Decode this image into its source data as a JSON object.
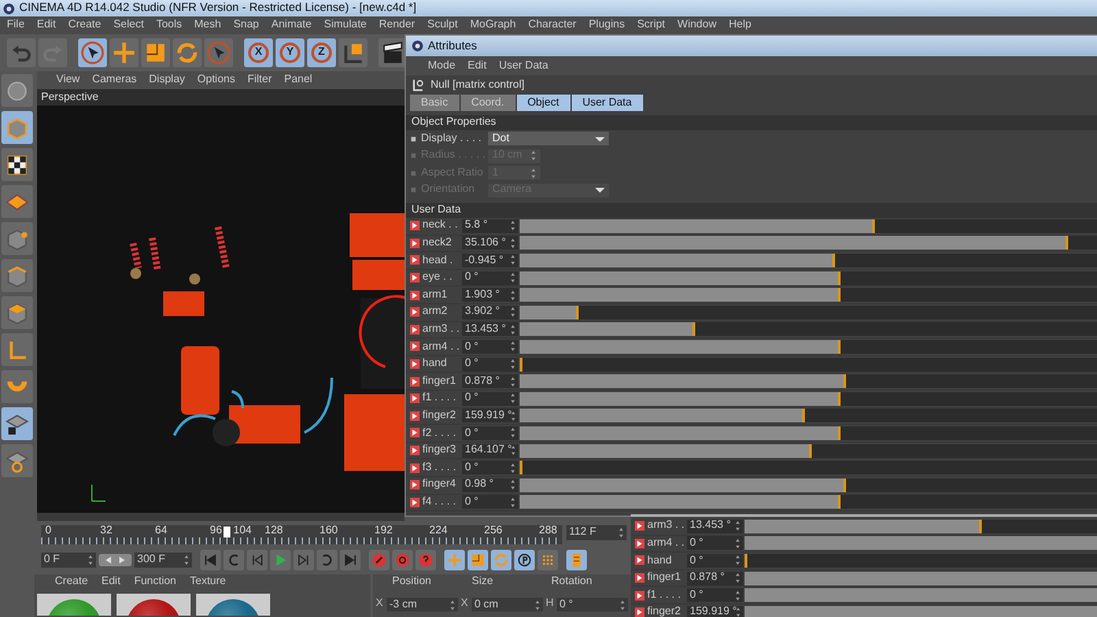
{
  "window": {
    "title": "CINEMA 4D R14.042 Studio (NFR Version - Restricted License) - [new.c4d *]"
  },
  "menu": [
    "File",
    "Edit",
    "Create",
    "Select",
    "Tools",
    "Mesh",
    "Snap",
    "Animate",
    "Simulate",
    "Render",
    "Sculpt",
    "MoGraph",
    "Character",
    "Plugins",
    "Script",
    "Window",
    "Help"
  ],
  "toolbar": [
    {
      "kind": "undo",
      "selected": false
    },
    {
      "kind": "redo",
      "selected": false
    },
    {
      "kind": "select",
      "selected": true
    },
    {
      "kind": "move",
      "selected": false
    },
    {
      "kind": "scale",
      "selected": false
    },
    {
      "kind": "rotate",
      "selected": false
    },
    {
      "kind": "select",
      "selected": false
    },
    {
      "kind": "axis",
      "label": "X",
      "selected": true
    },
    {
      "kind": "axis",
      "label": "Y",
      "selected": true
    },
    {
      "kind": "axis",
      "label": "Z",
      "selected": true
    },
    {
      "kind": "coord",
      "selected": false
    },
    {
      "kind": "clapper",
      "selected": false
    }
  ],
  "palette": [
    {
      "kind": "sculpt",
      "selected": false
    },
    {
      "kind": "cube",
      "selected": true
    },
    {
      "kind": "checker",
      "selected": false
    },
    {
      "kind": "plane",
      "selected": false
    },
    {
      "kind": "points",
      "selected": false
    },
    {
      "kind": "edges",
      "selected": false
    },
    {
      "kind": "faces",
      "selected": false
    },
    {
      "kind": "corner",
      "selected": false
    },
    {
      "kind": "magnet",
      "selected": false
    },
    {
      "kind": "lock",
      "selected": true
    },
    {
      "kind": "sync",
      "selected": false
    }
  ],
  "viewport": {
    "menu": [
      "View",
      "Cameras",
      "Display",
      "Options",
      "Filter",
      "Panel"
    ],
    "camera": "Perspective"
  },
  "attributes": {
    "title": "Attributes",
    "menu": [
      "Mode",
      "Edit",
      "User Data"
    ],
    "object": "Null [matrix control]",
    "tabs": [
      {
        "label": "Basic",
        "selected": false
      },
      {
        "label": "Coord.",
        "selected": false
      },
      {
        "label": "Object",
        "selected": true
      },
      {
        "label": "User Data",
        "selected": true
      }
    ],
    "object_properties": {
      "title": "Object Properties",
      "fields": [
        {
          "kind": "dropdown",
          "label": "Display . . . .",
          "value": "Dot",
          "disabled": false
        },
        {
          "kind": "number",
          "label": "Radius . . . . .",
          "value": "10 cm",
          "disabled": true
        },
        {
          "kind": "number",
          "label": "Aspect Ratio",
          "value": "1",
          "disabled": true
        },
        {
          "kind": "dropdown",
          "label": "Orientation",
          "value": "Camera",
          "disabled": true
        }
      ]
    },
    "user_data": {
      "title": "User Data",
      "rows": [
        {
          "label": "neck . .",
          "value": "5.8 °",
          "level": 0.61
        },
        {
          "label": "neck2",
          "value": "35.106 °",
          "level": 0.94
        },
        {
          "label": "head .",
          "value": "-0.945 °",
          "level": 0.54
        },
        {
          "label": "eye . .",
          "value": "0 °",
          "level": 0.55
        },
        {
          "label": "arm1",
          "value": "1.903 °",
          "level": 0.55
        },
        {
          "label": "arm2",
          "value": "3.902 °",
          "level": 0.1
        },
        {
          "label": "arm3 . .",
          "value": "13.453 °",
          "level": 0.3
        },
        {
          "label": "arm4 . .",
          "value": "0 °",
          "level": 0.55
        },
        {
          "label": "hand",
          "value": "0 °",
          "level": 0
        },
        {
          "label": "finger1",
          "value": "0.878 °",
          "level": 0.56
        },
        {
          "label": "f1 . . . .",
          "value": "0 °",
          "level": 0.55
        },
        {
          "label": "finger2",
          "value": "159.919 °",
          "level": 0.49
        },
        {
          "label": "f2 . . . .",
          "value": "0 °",
          "level": 0.55
        },
        {
          "label": "finger3",
          "value": "164.107 °",
          "level": 0.5
        },
        {
          "label": "f3 . . . .",
          "value": "0 °",
          "level": 0
        },
        {
          "label": "finger4",
          "value": "0.98 °",
          "level": 0.56
        },
        {
          "label": "f4 . . . .",
          "value": "0 °",
          "level": 0.55
        }
      ]
    }
  },
  "timeline": {
    "ticks": [
      "0",
      "32",
      "64",
      "96",
      "128",
      "160",
      "192",
      "224",
      "256",
      "288"
    ],
    "playhead": {
      "label": "104",
      "level": 0.347
    },
    "frame": "112 F"
  },
  "transport": {
    "start": "0 F",
    "end": "300 F",
    "buttons": [
      {
        "kind": "to-start",
        "selected": false
      },
      {
        "kind": "prev-key",
        "selected": false
      },
      {
        "kind": "prev-frame",
        "selected": false
      },
      {
        "kind": "play",
        "selected": false
      },
      {
        "kind": "next-frame",
        "selected": false
      },
      {
        "kind": "next-key",
        "selected": false
      },
      {
        "kind": "to-end",
        "selected": false
      },
      {
        "kind": "record",
        "selected": false
      },
      {
        "kind": "autokey",
        "selected": false
      },
      {
        "kind": "help",
        "selected": false
      },
      {
        "kind": "move",
        "selected": true
      },
      {
        "kind": "scale",
        "selected": true
      },
      {
        "kind": "rotate",
        "selected": true
      },
      {
        "kind": "param",
        "selected": true
      },
      {
        "kind": "dots",
        "selected": false
      },
      {
        "kind": "film",
        "selected": true
      }
    ]
  },
  "materials": {
    "menu": [
      "Create",
      "Edit",
      "Function",
      "Texture"
    ],
    "items": [
      {
        "color": "#2f9a2a"
      },
      {
        "color": "#b41515"
      },
      {
        "color": "#1b6a8c"
      }
    ]
  },
  "coordinates": {
    "columns": [
      "Position",
      "Size",
      "Rotation"
    ],
    "fields": [
      {
        "axis": "X",
        "value": "-3 cm"
      },
      {
        "axis": "X",
        "value": "0 cm"
      },
      {
        "axis": "H",
        "value": "0 °"
      }
    ]
  },
  "lower_panel": {
    "rows": [
      {
        "label": "arm3 . .",
        "value": "13.453 °",
        "level": 0.66
      },
      {
        "label": "arm4 . .",
        "value": "0 °",
        "level": 1
      },
      {
        "label": "hand",
        "value": "0 °",
        "level": 0
      },
      {
        "label": "finger1",
        "value": "0.878 °",
        "level": 1
      },
      {
        "label": "f1 . . . .",
        "value": "0 °",
        "level": 1
      },
      {
        "label": "finger2",
        "value": "159.919 °",
        "level": 1
      }
    ]
  }
}
